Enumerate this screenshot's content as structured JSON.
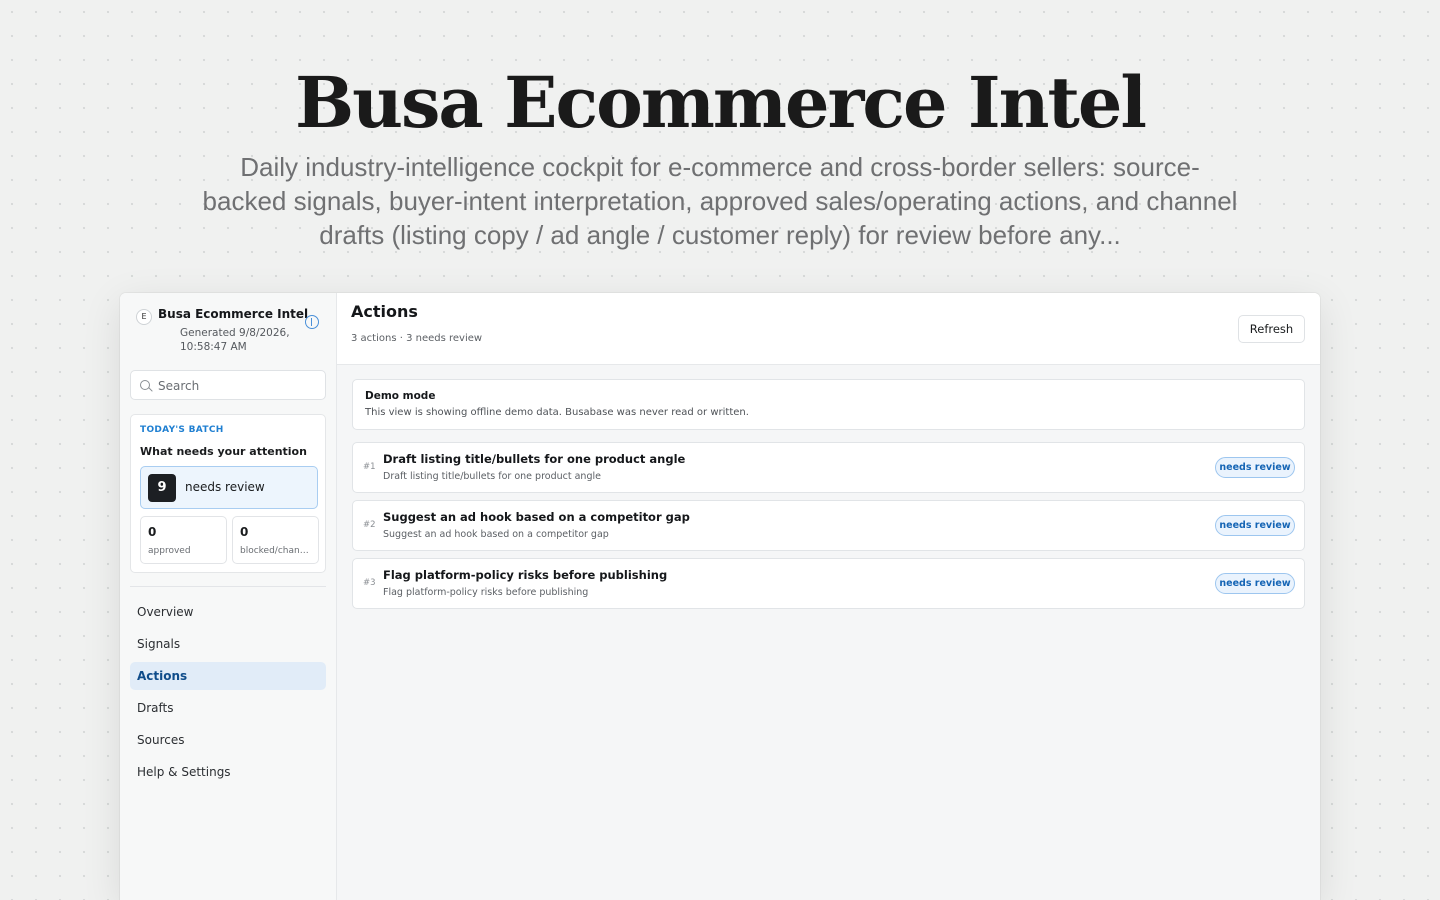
{
  "hero": {
    "title": "Busa Ecommerce Intel",
    "subtitle": "Daily industry-intelligence cockpit for e-commerce and cross-border sellers: source-backed signals, buyer-intent interpretation, approved sales/operating actions, and channel drafts (listing copy / ad angle / customer reply) for review before any..."
  },
  "sidebar": {
    "badge_letter": "E",
    "app_name": "Busa Ecommerce Intel",
    "generated": "Generated 9/8/2026, 10:58:47 AM",
    "search_placeholder": "Search",
    "batch": {
      "eyebrow": "TODAY'S BATCH",
      "title": "What needs your attention",
      "needs_review_count": "9",
      "needs_review_label": "needs review",
      "approved_count": "0",
      "approved_label": "approved",
      "blocked_count": "0",
      "blocked_label": "blocked/changes requested"
    },
    "nav": [
      "Overview",
      "Signals",
      "Actions",
      "Drafts",
      "Sources",
      "Help & Settings"
    ],
    "active_nav": "Actions"
  },
  "main": {
    "title": "Actions",
    "summary": "3 actions · 3 needs review",
    "refresh_label": "Refresh",
    "banner": {
      "title": "Demo mode",
      "text": "This view is showing offline demo data. Busabase was never read or written."
    },
    "actions": [
      {
        "num": "#1",
        "title": "Draft listing title/bullets for one product angle",
        "desc": "Draft listing title/bullets for one product angle",
        "status": "needs review"
      },
      {
        "num": "#2",
        "title": "Suggest an ad hook based on a competitor gap",
        "desc": "Suggest an ad hook based on a competitor gap",
        "status": "needs review"
      },
      {
        "num": "#3",
        "title": "Flag platform-policy risks before publishing",
        "desc": "Flag platform-policy risks before publishing",
        "status": "needs review"
      }
    ]
  },
  "colors": {
    "accent": "#1f7fd1",
    "active_nav_bg": "#e1ecf8",
    "badge_bg": "#eaf3fd",
    "dark_tile": "#1c1f23"
  },
  "icons": {
    "info": "info-icon",
    "search": "search-icon"
  }
}
